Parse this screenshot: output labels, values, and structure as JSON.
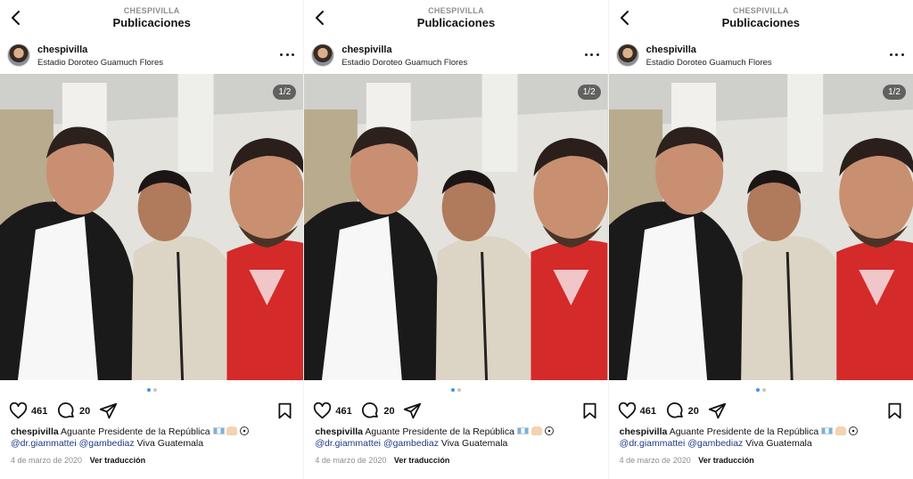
{
  "header": {
    "username": "CHESPIVILLA",
    "title": "Publicaciones"
  },
  "post": {
    "username": "chespivilla",
    "location": "Estadio Doroteo Guamuch Flores",
    "counter": "1/2",
    "likes": "461",
    "comments": "20",
    "caption_text": " Aguante Presidente de la República",
    "mention_1": "@dr.giammattei",
    "mention_2": "@gambediaz",
    "caption_tail": " Viva Guatemala",
    "date": "4 de marzo de 2020",
    "translate_label": "Ver traducción"
  },
  "icons": [
    "chevron-left-icon",
    "more-icon",
    "heart-icon",
    "comment-icon",
    "send-icon",
    "bookmark-icon"
  ],
  "colors": {
    "accent": "#3897f0",
    "mention": "#1e3a8a",
    "muted": "#8e8e8e"
  }
}
